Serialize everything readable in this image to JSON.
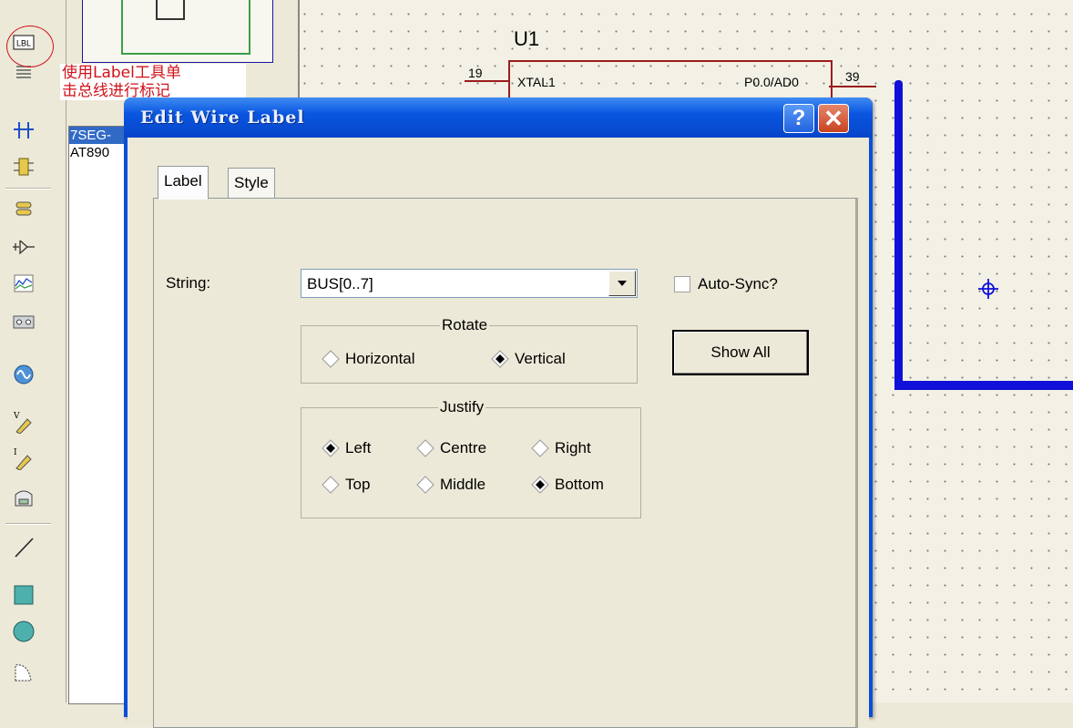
{
  "annotation": {
    "line1": "使用Label工具单",
    "line2": "击总线进行标记"
  },
  "toolbar": {
    "items": [
      {
        "name": "component-icon",
        "label": "LBL"
      }
    ]
  },
  "device_list": [
    "7SEG-",
    "AT890"
  ],
  "schematic": {
    "chip_ref": "U1",
    "left_pin_num": "19",
    "left_pin_name": "XTAL1",
    "right_pin_name": "P0.0/AD0",
    "right_pin_num": "39"
  },
  "dialog": {
    "title": "Edit Wire Label",
    "help_label": "?",
    "close_label": "✕",
    "tabs": [
      "Label",
      "Style"
    ],
    "string_label": "String:",
    "string_value": "BUS[0..7]",
    "autosync_label": "Auto-Sync?",
    "show_all_label": "Show All",
    "rotate": {
      "title": "Rotate",
      "options": [
        "Horizontal",
        "Vertical"
      ],
      "selected": "Vertical"
    },
    "justify": {
      "title": "Justify",
      "options": [
        "Left",
        "Centre",
        "Right",
        "Top",
        "Middle",
        "Bottom"
      ],
      "selected": [
        "Left",
        "Bottom"
      ]
    }
  },
  "colors": {
    "bus": "#1010d8",
    "accent": "#0a4fd8",
    "annotation": "#d0121b"
  }
}
